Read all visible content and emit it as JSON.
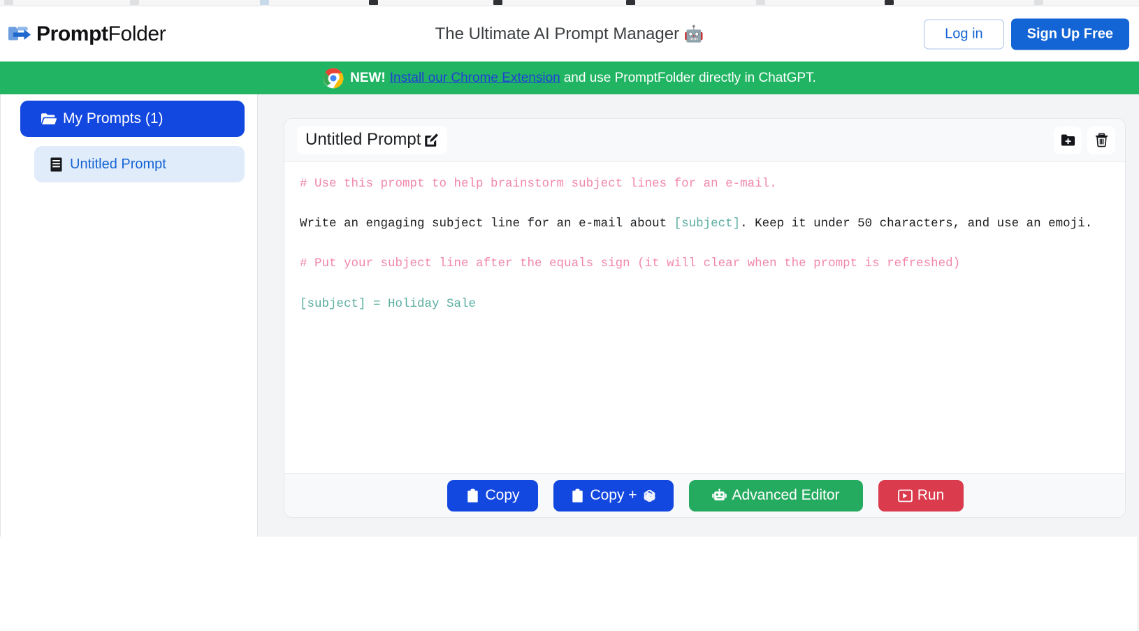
{
  "browser": {
    "bookmark_ticks": 9
  },
  "header": {
    "logo_bold": "Prompt",
    "logo_regular": "Folder",
    "logo_icon": "folder-arrow-icon",
    "tagline": "The Ultimate AI Prompt Manager",
    "tagline_emoji": "🤖",
    "login_label": "Log in",
    "signup_label": "Sign Up Free",
    "accent_blue": "#1364d4",
    "login_border": "#a9c4e9"
  },
  "banner": {
    "icon": "chrome-logo-icon",
    "new_label": "NEW!",
    "link_text": "Install our Chrome Extension",
    "after_text": "and use PromptFolder directly in ChatGPT.",
    "background": "#21b563",
    "link_color": "#1f3fd6"
  },
  "sidebar": {
    "folder": {
      "icon": "folder-open-icon",
      "label": "My Prompts (1)",
      "count": 1,
      "background": "#1348e0"
    },
    "items": [
      {
        "icon": "document-icon",
        "label": "Untitled Prompt",
        "selected": true,
        "background": "#e1ecfb",
        "text_color": "#1564d4"
      }
    ]
  },
  "card": {
    "title": "Untitled Prompt",
    "title_edit_icon": "pencil-square-icon",
    "head_actions": [
      {
        "name": "save-to-folder-button",
        "icon": "folder-plus-icon"
      },
      {
        "name": "delete-prompt-button",
        "icon": "trash-icon"
      }
    ],
    "editor": {
      "line1_comment": "# Use this prompt to help brainstorm subject lines for an e-mail.",
      "line2_pre": "Write an engaging subject line for an e-mail about ",
      "line2_var": "[subject]",
      "line2_post": ". Keep it under 50 characters, and use an emoji.",
      "line3_comment": "# Put your subject line after the equals sign (it will clear when the prompt is refreshed)",
      "line4_assignment": "[subject] = Holiday Sale",
      "comment_color": "#f187ab",
      "variable_color": "#5aada0",
      "text_color": "#1c1e21"
    },
    "footer_buttons": [
      {
        "name": "copy-button",
        "label": "Copy",
        "icon": "clipboard-icon",
        "color": "#1348e0"
      },
      {
        "name": "copy-and-open-chatgpt-button",
        "label": "Copy +",
        "icon": "clipboard-icon",
        "trailing_icon": "openai-logo-icon",
        "color": "#1348e0"
      },
      {
        "name": "advanced-editor-button",
        "label": "Advanced Editor",
        "icon": "robot-icon",
        "color": "#25ab60"
      },
      {
        "name": "run-button",
        "label": "Run",
        "icon": "terminal-play-icon",
        "color": "#da3b4d"
      }
    ]
  }
}
